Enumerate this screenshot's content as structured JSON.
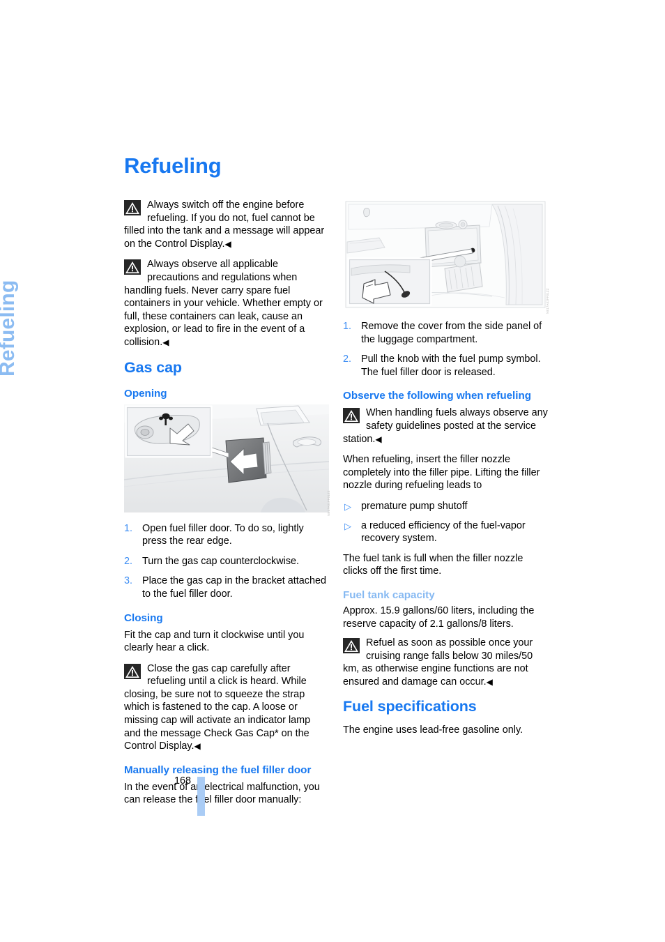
{
  "page": {
    "number": "168",
    "side_tab_label": "Refueling",
    "title": "Refueling",
    "colors": {
      "heading_blue": "#1878f0",
      "light_blue": "#86b9f2",
      "side_tab_blue": "#8cbcf2",
      "folio_bar_blue": "#aaccf5",
      "list_number_blue": "#3e8ef4"
    }
  },
  "left_column": {
    "warning_1": {
      "icon": "warning-triangle-icon",
      "text": "Always switch off the engine before refueling. If you do not, fuel cannot be filled into the tank and a message will appear on the Control Display.",
      "endmark": "◀"
    },
    "warning_2": {
      "icon": "warning-triangle-icon",
      "text": "Always observe all applicable precautions and regulations when handling fuels. Never carry spare fuel containers in your vehicle. Whether empty or full, these containers can leak, cause an explosion, or lead to fire in the event of a collision.",
      "endmark": "◀"
    },
    "gas_cap_heading": "Gas cap",
    "opening_heading": "Opening",
    "opening_figure": {
      "alt": "Car side view showing fuel filler door being pressed open, with inset detail of gas cap",
      "figure_id": "NE17A01FF01ZZ"
    },
    "opening_steps": [
      {
        "num": "1.",
        "text": "Open fuel filler door. To do so, lightly press the rear edge."
      },
      {
        "num": "2.",
        "text": "Turn the gas cap counterclockwise."
      },
      {
        "num": "3.",
        "text": "Place the gas cap in the bracket attached to the fuel filler door."
      }
    ],
    "closing_heading": "Closing",
    "closing_para": "Fit the cap and turn it clockwise until you clearly hear a click.",
    "closing_warning": {
      "icon": "warning-triangle-icon",
      "text": "Close the gas cap carefully after refueling until a click is heard. While closing, be sure not to squeeze the strap which is fastened to the cap. A loose or missing cap will activate an indicator lamp and the message Check Gas Cap* on the Control Display.",
      "endmark": "◀"
    },
    "manual_release_heading": "Manually releasing the fuel filler door",
    "manual_release_para": "In the event of an electrical malfunction, you can release the fuel filler door manually:"
  },
  "right_column": {
    "release_figure": {
      "alt": "Luggage compartment side panel with cover removed showing knob with fuel pump symbol, inset detail of pulling knob",
      "figure_id": "NE17A02FF01ZZ"
    },
    "release_steps": [
      {
        "num": "1.",
        "text": "Remove the cover from the side panel of the luggage compartment."
      },
      {
        "num": "2.",
        "text": "Pull the knob with the fuel pump symbol. The fuel filler door is released."
      }
    ],
    "observe_heading": "Observe the following when refueling",
    "observe_warning": {
      "icon": "warning-triangle-icon",
      "text": "When handling fuels always observe any safety guidelines posted at the service station.",
      "endmark": "◀"
    },
    "nozzle_para": "When refueling, insert the filler nozzle completely into the filler pipe. Lifting the filler nozzle during refueling leads to",
    "nozzle_bullets": [
      {
        "marker": "▷",
        "text": "premature pump shutoff"
      },
      {
        "marker": "▷",
        "text": "a reduced efficiency of the fuel-vapor recovery system."
      }
    ],
    "tank_full_para": "The fuel tank is full when the filler nozzle clicks off the first time.",
    "capacity_heading": "Fuel tank capacity",
    "capacity_para": "Approx. 15.9 gallons/60 liters, including the reserve capacity of 2.1 gallons/8 liters.",
    "capacity_warning": {
      "icon": "warning-triangle-icon",
      "text": "Refuel as soon as possible once your cruising range falls below 30 miles/50 km, as otherwise engine functions are not ensured and damage can occur.",
      "endmark": "◀"
    },
    "fuel_spec_heading": "Fuel specifications",
    "fuel_spec_para": "The engine uses lead-free gasoline only."
  }
}
